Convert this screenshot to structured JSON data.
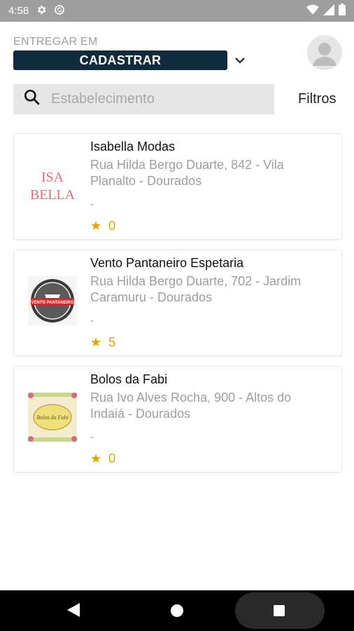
{
  "status_bar": {
    "time": "4:58",
    "icons": [
      "settings-icon",
      "sync-icon",
      "wifi-icon",
      "signal-icon",
      "battery-icon"
    ]
  },
  "header": {
    "deliver_label": "ENTREGAR EM",
    "address_button": "CADASTRAR",
    "brand_color": "#112b3e"
  },
  "search": {
    "placeholder": "Estabelecimento",
    "value": "",
    "filters_label": "Filtros"
  },
  "stores": [
    {
      "name": "Isabella Modas",
      "address": "Rua Hilda Bergo Duarte, 842 - Vila Planalto - Dourados",
      "extra": "-",
      "rating": "0",
      "logo_text_line1": "ISA",
      "logo_text_line2": "BELLA"
    },
    {
      "name": "Vento Pantaneiro Espetaria",
      "address": "Rua Hilda Bergo Duarte, 702 - Jardim Caramuru - Dourados",
      "extra": "-",
      "rating": "5",
      "logo_text_line1": "VENTO PANTANEIRO"
    },
    {
      "name": "Bolos da Fabi",
      "address": "Rua Ivo Alves Rocha, 900 - Altos do Indaiá - Dourados",
      "extra": "-",
      "rating": "0",
      "logo_text_line1": "Bolos da Fabi"
    }
  ],
  "rating_color": "#e0a400"
}
